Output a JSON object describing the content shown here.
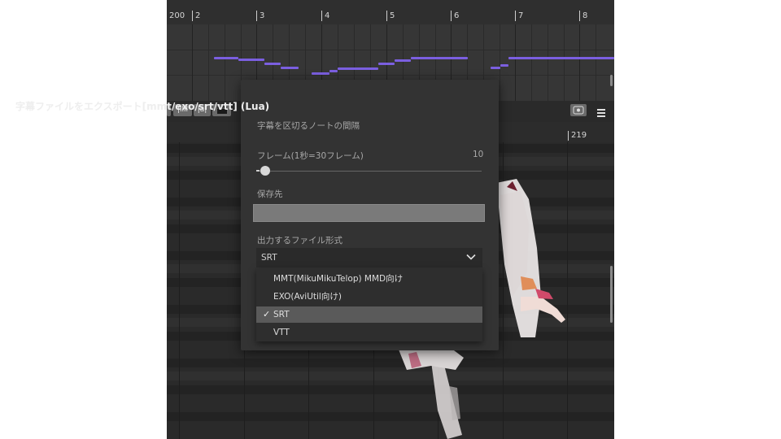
{
  "ruler": {
    "labels": [
      "200",
      "2",
      "3",
      "4",
      "5",
      "6",
      "7",
      "8"
    ]
  },
  "toolbar": {
    "buttons": [
      "|ılıl",
      "|a|",
      "clapper"
    ],
    "record_icon": "record-icon",
    "menu_icon": "hamburger-icon"
  },
  "ruler2": {
    "label": "219"
  },
  "dialog": {
    "title": "字幕ファイルをエクスポート[mmt/exo/srt/vtt] (Lua)",
    "subtitle": "字幕を区切るノートの間隔",
    "frame_label": "フレーム(1秒=30フレーム)",
    "frame_value": "10",
    "save_label": "保存先",
    "save_value": "",
    "format_label": "出力するファイル形式",
    "format_selected": "SRT",
    "options": [
      {
        "label": "MMT(MikuMikuTelop) MMD向け",
        "selected": false
      },
      {
        "label": "EXO(AviUtil向け)",
        "selected": false
      },
      {
        "label": "SRT",
        "selected": true
      },
      {
        "label": "VTT",
        "selected": false
      }
    ]
  },
  "colors": {
    "accent_pitch": "#7b5fe0",
    "dialog_bg": "#333333",
    "selected_option": "#5a5a5a"
  }
}
